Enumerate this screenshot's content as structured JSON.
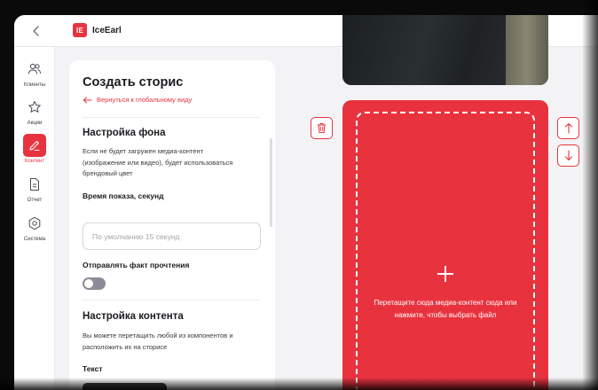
{
  "app": {
    "logo_mark": "IE",
    "logo_text": "IceEarl"
  },
  "topbar": {
    "back_icon": "chevron-left-icon"
  },
  "sidebar": {
    "items": [
      {
        "label": "Клиенты",
        "icon": "users-icon",
        "active": false
      },
      {
        "label": "Акции",
        "icon": "star-icon",
        "active": false
      },
      {
        "label": "Контент",
        "icon": "pencil-icon",
        "active": true
      },
      {
        "label": "Отчет",
        "icon": "document-icon",
        "active": false
      },
      {
        "label": "Система",
        "icon": "gear-icon",
        "active": false
      }
    ]
  },
  "panel": {
    "title": "Создать сторис",
    "back_link": "Вернуться к глобальному виду",
    "background_section": {
      "title": "Настройка фона",
      "description": "Если не будет загружен медиа-контент (изображение или видео), будет использоваться брендовый цвет",
      "duration_label": "Время показа, секунд",
      "duration_placeholder": "По умолчанию 15 секунд",
      "read_receipt_label": "Отправлять факт прочтения",
      "read_receipt_enabled": false
    },
    "content_section": {
      "title": "Настройка контента",
      "description": "Вы можете перетащить любой из компонентов и расположить их на сторисе",
      "text_label": "Текст"
    }
  },
  "preview": {
    "drop_text": "Перетащите сюда медиа-контент сюда или нажмите, чтобы выбрать файл"
  },
  "colors": {
    "accent": "#e8333f",
    "bg": "#f3f3f5",
    "panel": "#ffffff"
  }
}
